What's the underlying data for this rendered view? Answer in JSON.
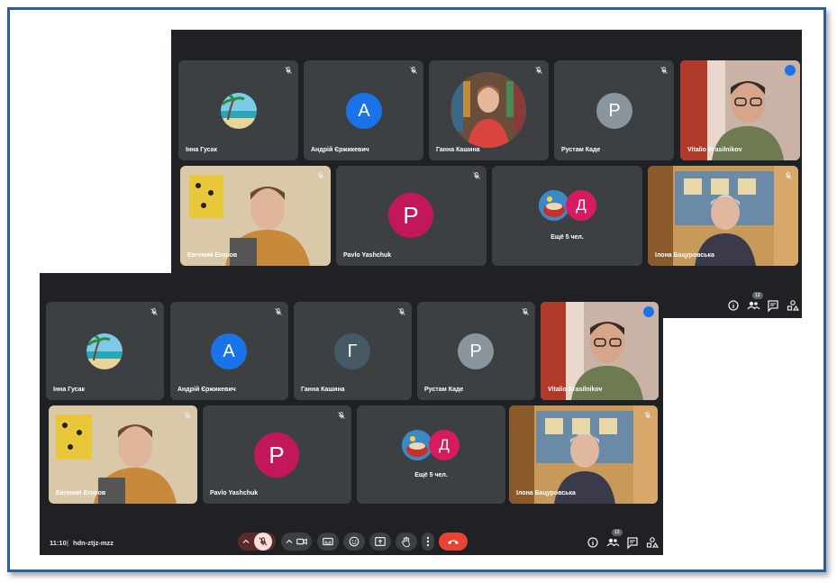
{
  "colors": {
    "accent": "#1a73e8",
    "leave": "#ea4335",
    "mic_off": "#f9dedc",
    "tile": "#3c4043",
    "background": "#202124"
  },
  "window_top": {
    "participants": [
      {
        "name": "Інна Гусак",
        "avatar": "beach-image"
      },
      {
        "name": "Андрій Єржикевич",
        "initial": "A",
        "color": "#1a73e8"
      },
      {
        "name": "Ганна Кашина",
        "avatar": "photo"
      },
      {
        "name": "Рустам Каде",
        "initial": "Р",
        "color": "#8a959e"
      },
      {
        "name": "Vitalio Krasilnikov",
        "speaking": true
      },
      {
        "name": "Евгений Егоров"
      },
      {
        "name": "Pavlo Yashchuk",
        "initial": "P",
        "color": "#c2185b"
      },
      {
        "name": "Ещё 5 чел.",
        "initial": "Д",
        "color": "#d81b60"
      },
      {
        "name": "Ілона Бацуровська"
      }
    ],
    "people_count": "13"
  },
  "window_bottom": {
    "participants": [
      {
        "name": "Інна Гусак",
        "avatar": "beach-image"
      },
      {
        "name": "Андрій Єржикевич",
        "initial": "A",
        "color": "#1a73e8"
      },
      {
        "name": "Ганна Кашина",
        "initial": "Г",
        "color": "#455a64"
      },
      {
        "name": "Рустам Каде",
        "initial": "Р",
        "color": "#8a959e"
      },
      {
        "name": "Vitalio Krasilnikov",
        "speaking": true
      },
      {
        "name": "Евгений Егоров"
      },
      {
        "name": "Pavlo Yashchuk",
        "initial": "P",
        "color": "#c2185b"
      },
      {
        "name": "Ещё 5 чел.",
        "initial": "Д",
        "color": "#d81b60"
      },
      {
        "name": "Ілона Бацуровська"
      }
    ],
    "people_count": "13",
    "time": "11:10",
    "separator": "|",
    "meeting_code": "hdn-ztjz-mzz"
  },
  "icons": [
    "mic-off-icon",
    "camera-icon",
    "captions-icon",
    "emoji-icon",
    "present-icon",
    "raise-hand-icon",
    "more-options-icon",
    "end-call-icon",
    "info-icon",
    "people-icon",
    "chat-icon",
    "activities-icon",
    "chevron-up-icon"
  ]
}
